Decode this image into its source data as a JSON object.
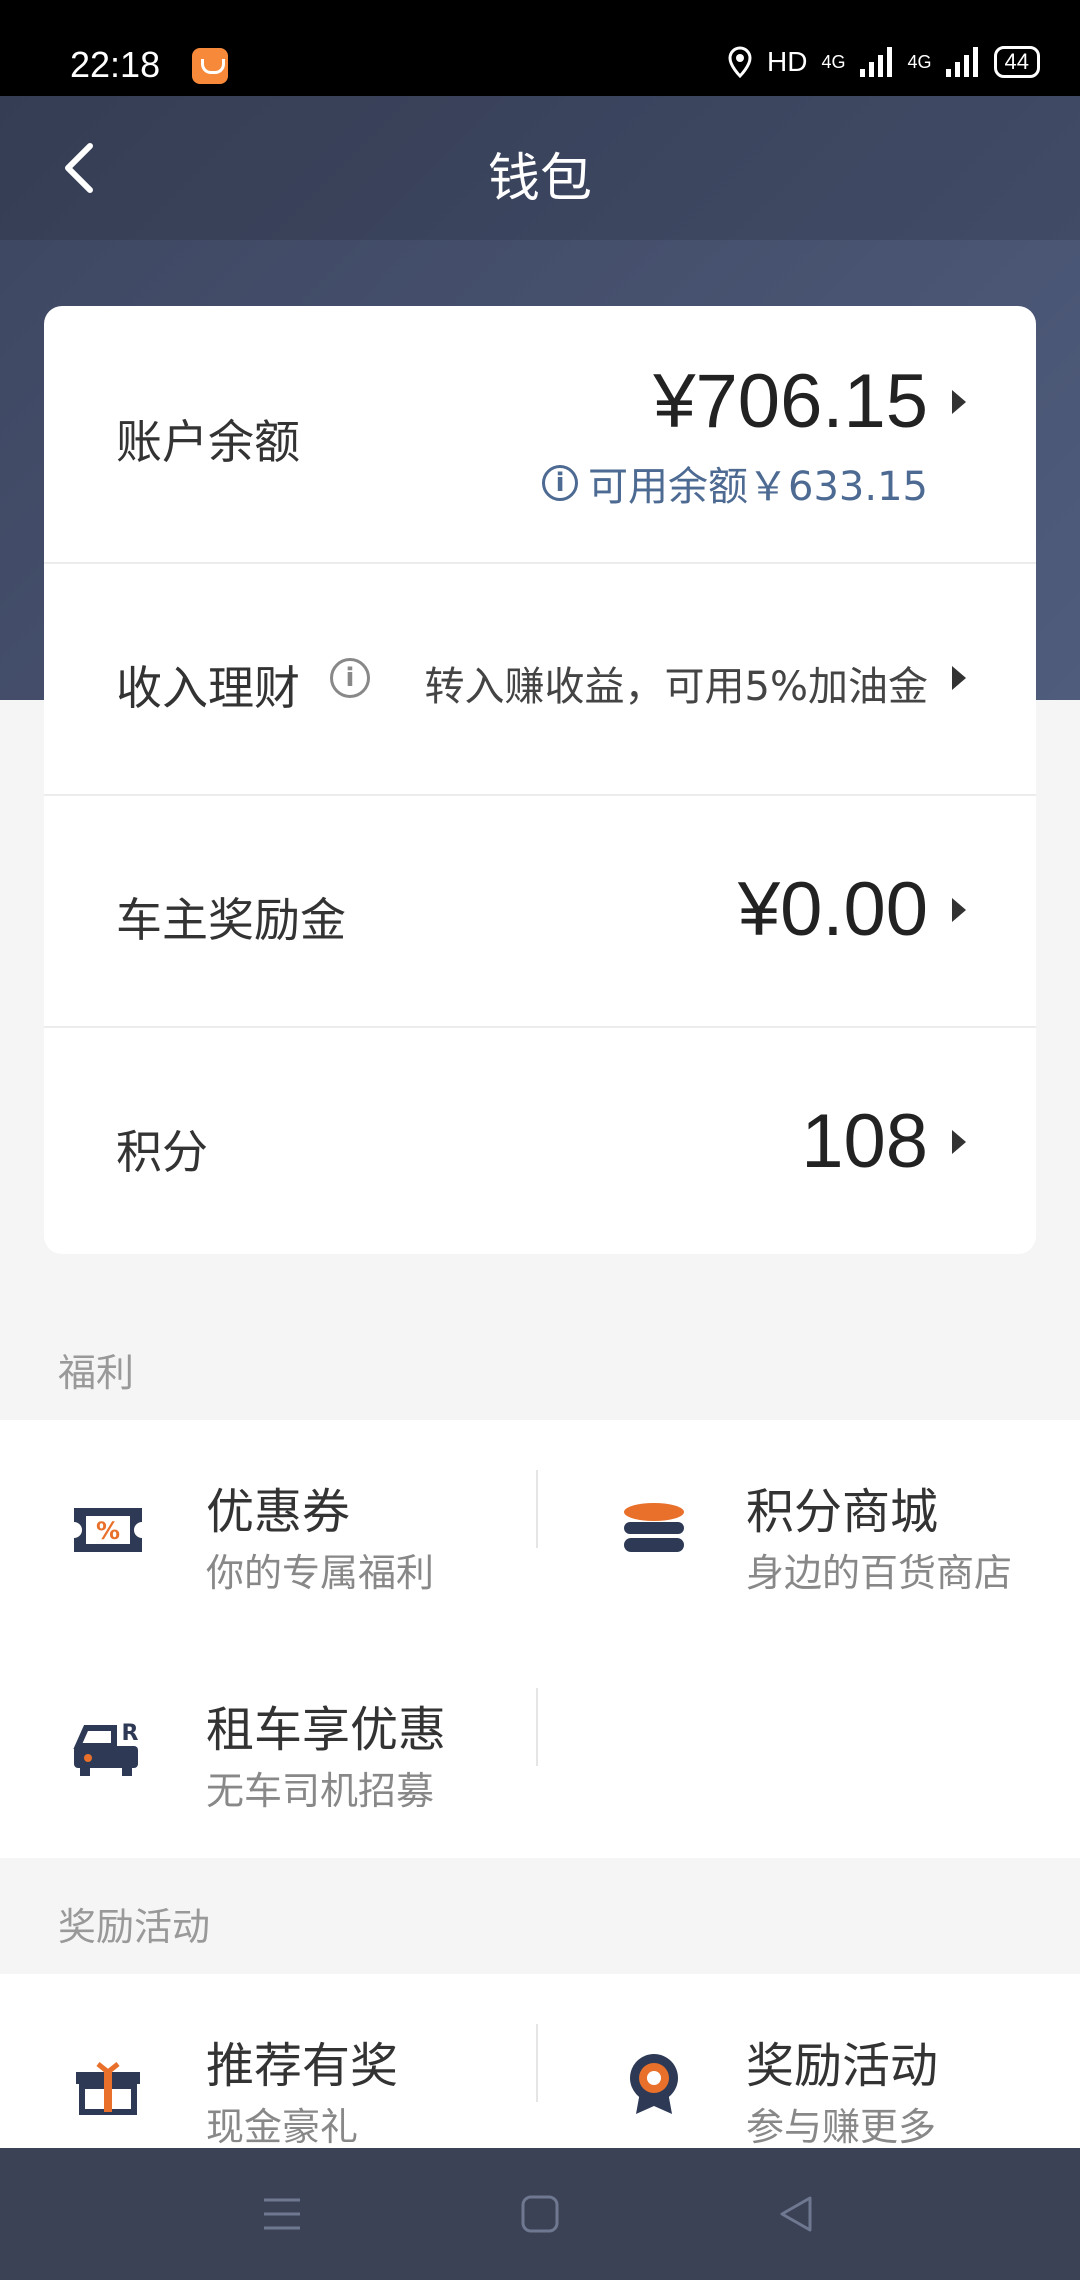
{
  "status_bar": {
    "time": "22:18",
    "net_label": "HD",
    "sig1": "4G",
    "sig2": "4G",
    "battery": "44"
  },
  "header": {
    "title": "钱包"
  },
  "wallet": {
    "balance": {
      "label": "账户余额",
      "value": "¥706.15",
      "available": "可用余额￥633.15"
    },
    "finance": {
      "label": "收入理财",
      "hint": "转入赚收益，可用5%加油金"
    },
    "bonus": {
      "label": "车主奖励金",
      "value": "¥0.00"
    },
    "points": {
      "label": "积分",
      "value": "108"
    }
  },
  "welfare": {
    "title": "福利",
    "items": [
      {
        "title": "优惠券",
        "subtitle": "你的专属福利",
        "icon": "coupon-icon"
      },
      {
        "title": "积分商城",
        "subtitle": "身边的百货商店",
        "icon": "coin-stack-icon"
      },
      {
        "title": "租车享优惠",
        "subtitle": "无车司机招募",
        "icon": "rental-car-icon"
      }
    ]
  },
  "rewards": {
    "title": "奖励活动",
    "items": [
      {
        "title": "推荐有奖",
        "subtitle": "现金豪礼",
        "icon": "gift-icon"
      },
      {
        "title": "奖励活动",
        "subtitle": "参与赚更多",
        "icon": "medal-icon"
      }
    ]
  },
  "colors": {
    "header": "#4a5674",
    "accent_orange": "#e8702a",
    "icon_navy": "#2e3a55",
    "available_text": "#4d6a92"
  }
}
